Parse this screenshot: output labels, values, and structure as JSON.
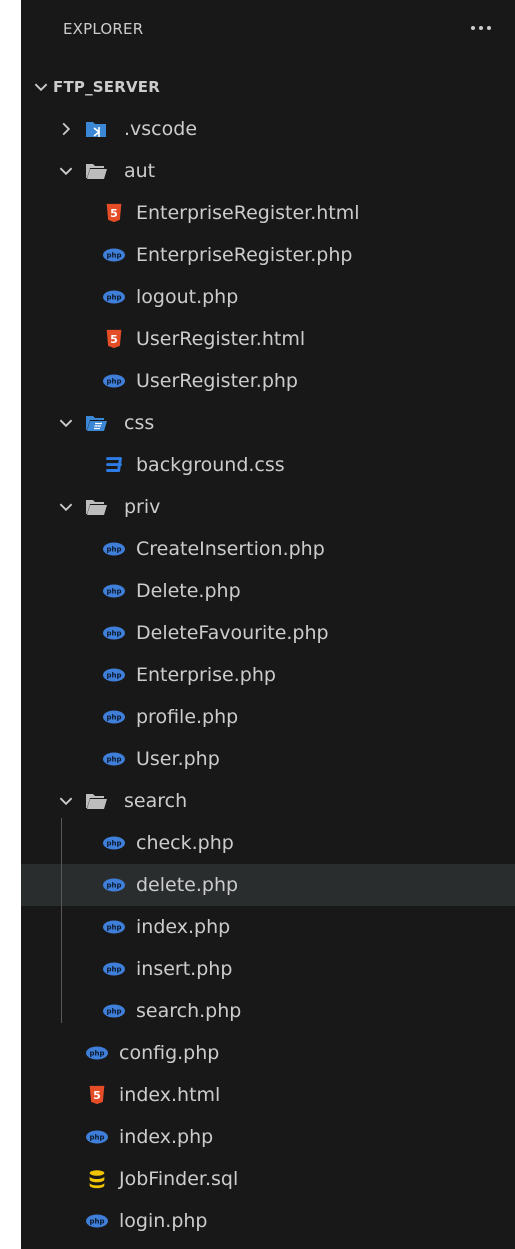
{
  "explorer": {
    "title": "EXPLORER",
    "more_actions_icon": "ellipsis-icon"
  },
  "root": {
    "name": "FTP_SERVER",
    "expanded": true
  },
  "colors": {
    "background": "#181818",
    "text": "#cccccc",
    "php": "#3f7fd9",
    "html": "#e44d26",
    "css": "#2d7be5",
    "sql": "#f0c400",
    "folder": "#bdbdbd",
    "vscode_folder": "#3b87d6"
  },
  "tree": [
    {
      "name": ".vscode",
      "kind": "folder",
      "icon": "vscode-folder-icon",
      "expanded": false
    },
    {
      "name": "aut",
      "kind": "folder",
      "icon": "folder-open-icon",
      "expanded": true
    },
    {
      "name": "EnterpriseRegister.html",
      "kind": "file",
      "icon": "html-icon"
    },
    {
      "name": "EnterpriseRegister.php",
      "kind": "file",
      "icon": "php-icon"
    },
    {
      "name": "logout.php",
      "kind": "file",
      "icon": "php-icon"
    },
    {
      "name": "UserRegister.html",
      "kind": "file",
      "icon": "html-icon"
    },
    {
      "name": "UserRegister.php",
      "kind": "file",
      "icon": "php-icon"
    },
    {
      "name": "css",
      "kind": "folder",
      "icon": "css-folder-icon",
      "expanded": true
    },
    {
      "name": "background.css",
      "kind": "file",
      "icon": "css-icon"
    },
    {
      "name": "priv",
      "kind": "folder",
      "icon": "folder-open-icon",
      "expanded": true
    },
    {
      "name": "CreateInsertion.php",
      "kind": "file",
      "icon": "php-icon"
    },
    {
      "name": "Delete.php",
      "kind": "file",
      "icon": "php-icon"
    },
    {
      "name": "DeleteFavourite.php",
      "kind": "file",
      "icon": "php-icon"
    },
    {
      "name": "Enterprise.php",
      "kind": "file",
      "icon": "php-icon"
    },
    {
      "name": "profile.php",
      "kind": "file",
      "icon": "php-icon"
    },
    {
      "name": "User.php",
      "kind": "file",
      "icon": "php-icon"
    },
    {
      "name": "search",
      "kind": "folder",
      "icon": "folder-open-icon",
      "expanded": true
    },
    {
      "name": "check.php",
      "kind": "file",
      "icon": "php-icon"
    },
    {
      "name": "delete.php",
      "kind": "file",
      "icon": "php-icon",
      "selected": true
    },
    {
      "name": "index.php",
      "kind": "file",
      "icon": "php-icon"
    },
    {
      "name": "insert.php",
      "kind": "file",
      "icon": "php-icon"
    },
    {
      "name": "search.php",
      "kind": "file",
      "icon": "php-icon"
    },
    {
      "name": "config.php",
      "kind": "file",
      "icon": "php-icon"
    },
    {
      "name": "index.html",
      "kind": "file",
      "icon": "html-icon"
    },
    {
      "name": "index.php",
      "kind": "file",
      "icon": "php-icon"
    },
    {
      "name": "JobFinder.sql",
      "kind": "file",
      "icon": "database-icon"
    },
    {
      "name": "login.php",
      "kind": "file",
      "icon": "php-icon"
    }
  ]
}
